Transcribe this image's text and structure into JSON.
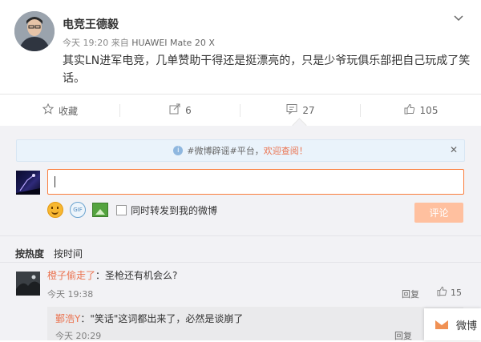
{
  "post": {
    "author": "电竞王德毅",
    "time": "今天 19:20",
    "source_prefix": "来自",
    "device": "HUAWEI Mate 20 X",
    "text": "其实LN进军电竞，几单赞助干得还是挺漂亮的，只是少爷玩俱乐部把自己玩成了笑话。",
    "more_icon": "chevron-down-icon"
  },
  "actions": {
    "favorite": {
      "label": "收藏",
      "icon": "star-icon"
    },
    "forward": {
      "label": "6",
      "icon": "share-icon"
    },
    "comment": {
      "label": "27",
      "icon": "comment-icon"
    },
    "like": {
      "label": "105",
      "icon": "thumbs-up-icon"
    }
  },
  "comment_box": {
    "notice_prefix": "#微博辟谣#平台，",
    "notice_link": "欢迎查阅！",
    "forward_checkbox_label": "同时转发到我的微博",
    "submit_label": "评论",
    "gif_label": "GIF"
  },
  "sort": {
    "hot": "按热度",
    "time": "按时间"
  },
  "comments": [
    {
      "user": "橙子偷走了",
      "text": "：圣枪还有机会么?",
      "time": "今天 19:38",
      "reply": "回复",
      "likes": "15",
      "replies": [
        {
          "user": "鄞浩Y",
          "text": "：\"笑话\"这词都出来了，必然是谈崩了",
          "time": "今天 20:29",
          "reply": "回复"
        }
      ]
    }
  ],
  "chat": {
    "label": "微博"
  },
  "colors": {
    "accent": "#eb7350",
    "input_border": "#fa7d3c",
    "submit_disabled": "#ffc09f",
    "panel_bg": "#f2f2f5"
  }
}
